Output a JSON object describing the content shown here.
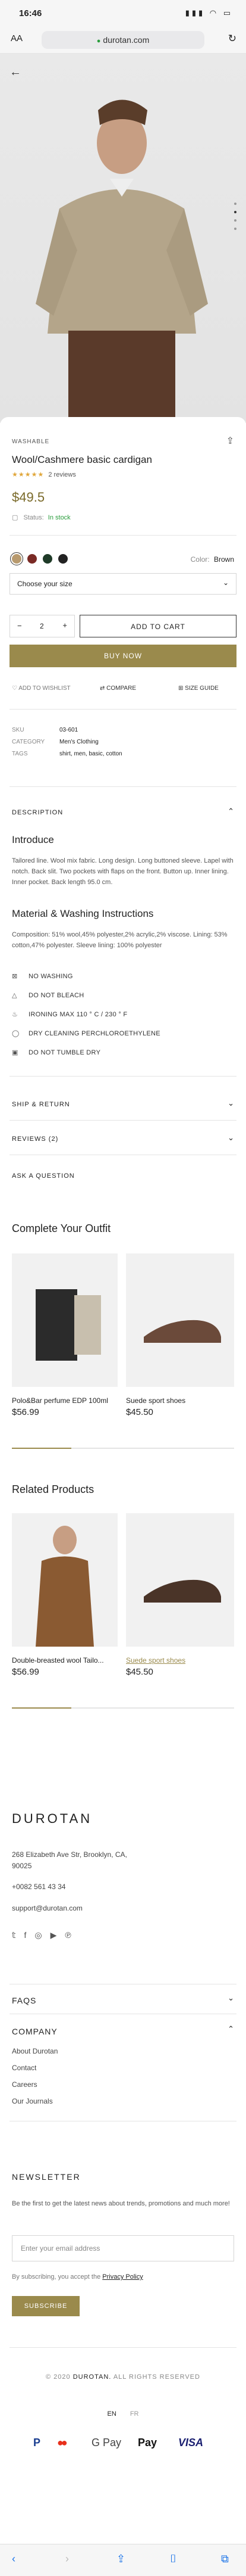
{
  "status": {
    "time": "16:46",
    "icons": "▮▮▮ ◠ ▭"
  },
  "browser": {
    "aa": "AA",
    "url": "durotan.com",
    "lock_icon": "lock-icon",
    "reload_icon": "reload-icon"
  },
  "product": {
    "brand": "WASHABLE",
    "title": "Wool/Cashmere basic cardigan",
    "stars": "★★★★★",
    "reviews": "2 reviews",
    "price": "$49.5",
    "status_label": "Status:",
    "status_value": "In stock",
    "color_label": "Color:",
    "color_value": "Brown",
    "colors": [
      "#b89a6e",
      "#7a2a25",
      "#1f3b28",
      "#222222"
    ],
    "size_placeholder": "Choose your size",
    "qty": "2",
    "add_to_cart": "ADD TO CART",
    "buy_now": "BUY NOW",
    "wishlist": "ADD TO WISHLIST",
    "compare": "COMPARE",
    "size_guide": "SIZE GUIDE",
    "meta": [
      {
        "label": "SKU",
        "value": "03-601"
      },
      {
        "label": "CATEGORY",
        "value": "Men's Clothing"
      },
      {
        "label": "TAGS",
        "value": "shirt, men, basic, cotton"
      }
    ]
  },
  "description": {
    "heading": "DESCRIPTION",
    "intro_title": "Introduce",
    "intro_text": "Tailored line. Wool mix fabric. Long design. Long buttoned sleeve. Lapel with notch. Back slit. Two pockets with flaps on the front. Button up. Inner lining. Inner pocket. Back length 95.0 cm.",
    "material_title": "Material & Washing Instructions",
    "composition": "Composition: 51% wool,45% polyester,2% acrylic,2% viscose. Lining: 53% cotton,47% polyester. Sleeve lining: 100% polyester",
    "care": [
      "NO WASHING",
      "DO NOT BLEACH",
      "IRONING MAX 110 ° C / 230 ° F",
      "DRY CLEANING PERCHLOROETHYLENE",
      "DO NOT TUMBLE DRY"
    ]
  },
  "accordions": {
    "ship": "SHIP & RETURN",
    "reviews": "REVIEWS (2)",
    "ask": "ASK A QUESTION"
  },
  "outfit": {
    "title": "Complete Your Outfit",
    "items": [
      {
        "name": "Polo&Bar perfume EDP 100ml",
        "price": "$56.99"
      },
      {
        "name": "Suede sport shoes",
        "price": "$45.50"
      }
    ]
  },
  "related": {
    "title": "Related Products",
    "items": [
      {
        "name": "Double-breasted wool Tailo...",
        "price": "$56.99"
      },
      {
        "name": "Suede sport shoes",
        "price": "$45.50"
      }
    ]
  },
  "footer": {
    "brand": "DUROTAN",
    "address": "268 Elizabeth Ave Str, Brooklyn, CA, 90025",
    "phone": "+0082 561 43 34",
    "email": "support@durotan.com",
    "faqs": "FAQS",
    "company": "COMPANY",
    "company_links": [
      "About Durotan",
      "Contact",
      "Careers",
      "Our Journals"
    ],
    "newsletter_title": "NEWSLETTER",
    "newsletter_text": "Be the first to get the latest news about trends, promotions and much more!",
    "email_placeholder": "Enter your email address",
    "consent_prefix": "By subscribing, you accept the",
    "consent_link": "Privacy Policy",
    "subscribe": "SUBSCRIBE",
    "copyright_prefix": "© 2020",
    "copyright_brand": "DUROTAN.",
    "copyright_suffix": "ALL RIGHTS RESERVED",
    "lang_en": "EN",
    "lang_fr": "FR",
    "payments": [
      "P",
      "●●",
      "G Pay",
      " Pay",
      "VISA"
    ]
  },
  "colors": {
    "accent": "#9a8a4c",
    "gold": "#7a6a2a",
    "green": "#2a9d3c"
  }
}
